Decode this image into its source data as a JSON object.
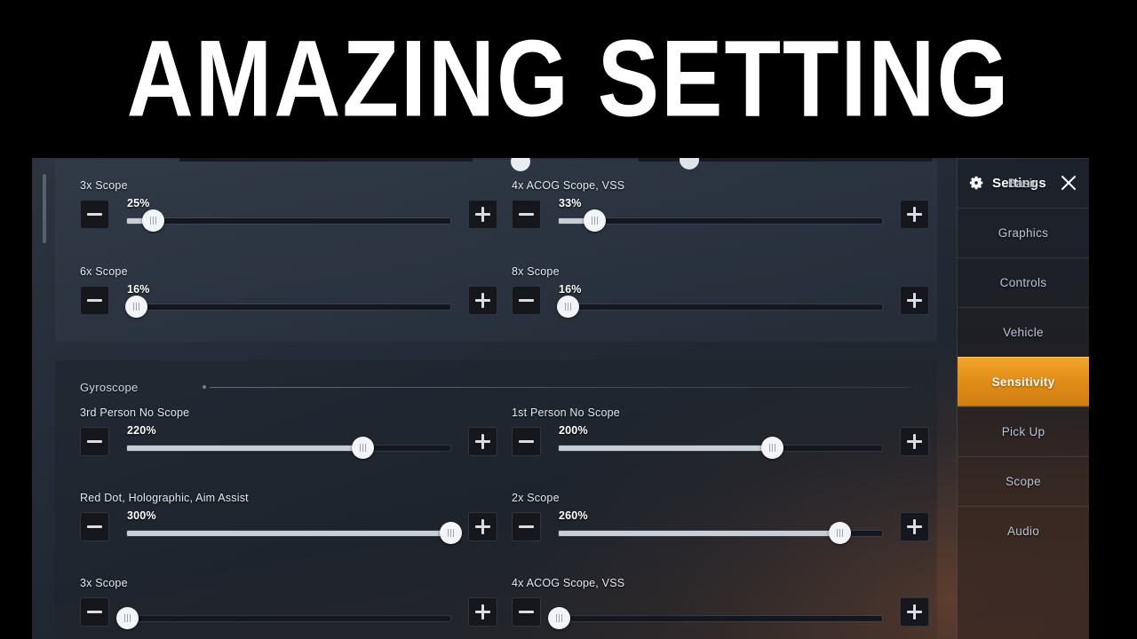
{
  "banner": {
    "title": "AMAZING SETTING"
  },
  "sidebar": {
    "title": "Settings",
    "gear_icon": "gear-icon",
    "close_icon": "close-icon",
    "accent_color": "#e08c18",
    "items": [
      {
        "label": "Basic",
        "active": false
      },
      {
        "label": "Graphics",
        "active": false
      },
      {
        "label": "Controls",
        "active": false
      },
      {
        "label": "Vehicle",
        "active": false
      },
      {
        "label": "Sensitivity",
        "active": true
      },
      {
        "label": "Pick Up",
        "active": false
      },
      {
        "label": "Scope",
        "active": false
      },
      {
        "label": "Audio",
        "active": false
      }
    ]
  },
  "panels": [
    {
      "id": "scope",
      "section_label": "",
      "rows": [
        {
          "label": "3x Scope",
          "value": "25%",
          "percent": 8,
          "column": "left"
        },
        {
          "label": "4x ACOG Scope, VSS",
          "value": "33%",
          "percent": 11,
          "column": "right"
        },
        {
          "label": "6x Scope",
          "value": "16%",
          "percent": 3,
          "column": "left"
        },
        {
          "label": "8x Scope",
          "value": "16%",
          "percent": 3,
          "column": "right"
        }
      ]
    },
    {
      "id": "gyroscope",
      "section_label": "Gyroscope",
      "rows": [
        {
          "label": "3rd Person No Scope",
          "value": "220%",
          "percent": 73,
          "column": "left"
        },
        {
          "label": "1st Person No Scope",
          "value": "200%",
          "percent": 66,
          "column": "right"
        },
        {
          "label": "Red Dot, Holographic, Aim Assist",
          "value": "300%",
          "percent": 100,
          "column": "left"
        },
        {
          "label": "2x Scope",
          "value": "260%",
          "percent": 87,
          "column": "right"
        },
        {
          "label": "3x Scope",
          "value": "",
          "percent": 0,
          "column": "left"
        },
        {
          "label": "4x ACOG Scope, VSS",
          "value": "",
          "percent": 0,
          "column": "right"
        }
      ]
    }
  ],
  "buttons": {
    "decrease_label": "−",
    "increase_label": "+"
  }
}
